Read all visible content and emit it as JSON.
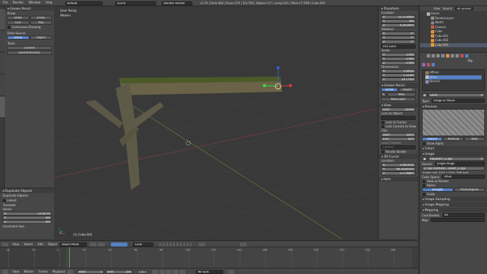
{
  "topbar": {
    "menus": [
      "File",
      "Render",
      "Window",
      "Help"
    ],
    "layout": "Default",
    "scene": "Scene",
    "engine": "Blender Render",
    "stats": "v2.76 | Verts:464 | Faces:270 | Tris:740 | Objects:1/7 | Lamps:0/1 | Mem:17.55M | Cube.003"
  },
  "tool_panel": {
    "title": "Grease Pencil",
    "draw_label": "Draw:",
    "draw_buttons": [
      "Draw",
      "Erase",
      "Line",
      "Poly"
    ],
    "continuous": "Continuous Drawing",
    "data_source_label": "Data Source:",
    "data_source": [
      "Scene",
      "Object"
    ],
    "tools_label": "Tools:",
    "tools_buttons": [
      "Convert",
      "Ruler/Protractor"
    ],
    "vtabs": [
      "Tools",
      "Create",
      "Relations",
      "Animation",
      "Physics",
      "Grease Pencil"
    ]
  },
  "operator_panel": {
    "title": "Duplicate Objects",
    "subtitle": "Duplicate Objects",
    "linked": "Linked",
    "translate_label": "Translate",
    "vector_label": "Vector",
    "x": "12.817m",
    "y": "0m",
    "z": "0m",
    "constraint": "Constraint Axis"
  },
  "viewport": {
    "view_label": "User Persp",
    "units": "Meters",
    "object_label": "(1) Cube.003"
  },
  "view3d_header": {
    "menus": [
      "View",
      "Select",
      "Add",
      "Object"
    ],
    "mode": "Object Mode",
    "pivot": "Local"
  },
  "n_panel": {
    "transform_title": "Transform",
    "location_label": "Location:",
    "location": [
      {
        "axis": "X:",
        "value": "12.37348m"
      },
      {
        "axis": "Y:",
        "value": "0m"
      },
      {
        "axis": "Z:",
        "value": "4.26546m"
      }
    ],
    "rotation_label": "Rotation:",
    "rotation": [
      {
        "axis": "X:",
        "value": "0°"
      },
      {
        "axis": "Y:",
        "value": "0°"
      },
      {
        "axis": "Z:",
        "value": "0°"
      }
    ],
    "rotation_mode": "XYZ Euler",
    "scale_label": "Scale:",
    "scale": [
      {
        "axis": "X:",
        "value": "3.000"
      },
      {
        "axis": "Y:",
        "value": "3.000"
      },
      {
        "axis": "Z:",
        "value": "3.000"
      }
    ],
    "dimensions_label": "Dimensions:",
    "dimensions": [
      {
        "axis": "X:",
        "value": "3.044m"
      },
      {
        "axis": "Y:",
        "value": "1.313m"
      },
      {
        "axis": "Z:",
        "value": "19.174m"
      }
    ],
    "grease_title": "Grease Pencil",
    "grease_source": [
      "Scene",
      "Object"
    ],
    "grease_new": "New",
    "new_layer": "New Layer",
    "view_title": "View",
    "lens_label": "Lens:",
    "lens": "35mm",
    "lock_obj_label": "Lock to Object:",
    "lock_cursor": "Lock to Cursor",
    "lock_camera": "Lock Camera to View",
    "clip_label": "Clip:",
    "clip_start_label": "Start:",
    "clip_start": "10cm",
    "clip_end_label": "End:",
    "clip_end": "1km",
    "local_camera_label": "Local Camera",
    "local_camera": "Camera",
    "render_border": "Render Border",
    "cursor_title": "3D Cursor",
    "cursor_loc_label": "Location:",
    "cursor": [
      {
        "axis": "X:",
        "value": "2.68185m"
      },
      {
        "axis": "Y:",
        "value": "88.34305cm"
      },
      {
        "axis": "Z:",
        "value": "2.17388m"
      }
    ],
    "item_title": "Item"
  },
  "outliner": {
    "menus": [
      "View",
      "Search",
      "All Scenes"
    ],
    "items": [
      {
        "name": "Scene",
        "indent": 0
      },
      {
        "name": "RenderLayers",
        "indent": 1
      },
      {
        "name": "World",
        "indent": 1
      },
      {
        "name": "Camera",
        "indent": 1
      },
      {
        "name": "Cube",
        "indent": 1
      },
      {
        "name": "Cube.001",
        "indent": 1
      },
      {
        "name": "Cube.002",
        "indent": 1
      },
      {
        "name": "Cube.003",
        "indent": 1
      }
    ]
  },
  "properties": {
    "breadcrumb": "Big",
    "slots": [
      "diffuse",
      "Gloss",
      "Normal"
    ],
    "texture_name": "Gloss",
    "type_label": "Type:",
    "type_value": "Image or Movie",
    "preview_title": "Preview",
    "preview_tabs": [
      "Texture",
      "Material",
      "Both"
    ],
    "show_alpha": "Show Alpha",
    "colors": "Colors",
    "image_title": "Image",
    "image_name": "RapaBkt7_G.tga",
    "source_label": "Source:",
    "source_value": "Single Image",
    "filepath": "//..\\SD Institute\\...asket\\_G.tga",
    "image_info": "Image: size 1024 x 1024, RGB byte",
    "color_space_label": "Color Space:",
    "color_space": "sRGB",
    "view_as_render": "View as Render",
    "alpha_label": "Alpha:",
    "alpha_buttons": [
      "Straight",
      "Premultiplied"
    ],
    "fields_label": "Fields",
    "image_sampling": "Image Sampling",
    "image_mapping": "Image Mapping",
    "mapping_title": "Mapping",
    "coords_label": "Coordinates:",
    "coords_value": "UV",
    "map_label": "Map:"
  },
  "timeline": {
    "ticks": [
      "-40",
      "-20",
      "0",
      "20",
      "40",
      "60",
      "80",
      "100",
      "120",
      "140",
      "160",
      "180",
      "200",
      "220",
      "240",
      "260"
    ],
    "menus": [
      "View",
      "Marker",
      "Frame",
      "Playback"
    ],
    "start_label": "Start:",
    "start": "1",
    "end_label": "End:",
    "end": "250",
    "current": "1",
    "sync": "No Sync"
  },
  "colors": {
    "accent": "#5680c2",
    "active_orange": "#f0a030"
  }
}
